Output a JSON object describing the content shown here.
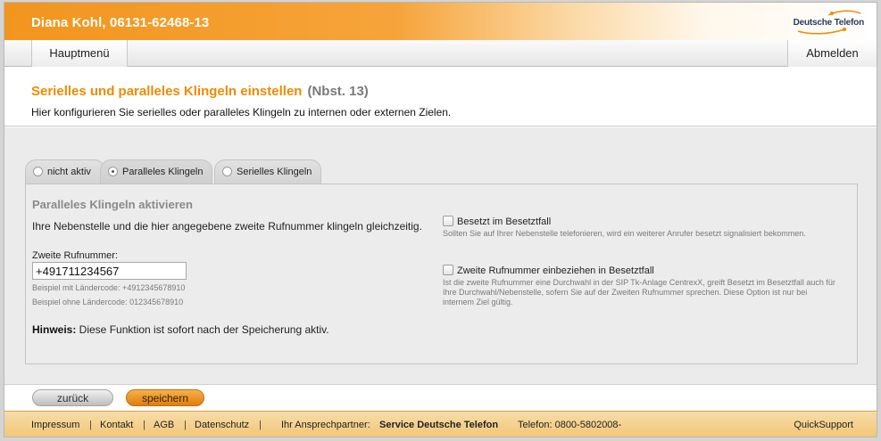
{
  "header": {
    "user": "Diana Kohl, 06131-62468-13",
    "logo_text": "Deutsche Telefon"
  },
  "nav": {
    "main_menu": "Hauptmenü",
    "logout": "Abmelden"
  },
  "page": {
    "title": "Serielles und paralleles Klingeln einstellen",
    "extension": "(Nbst. 13)",
    "description": "Hier konfigurieren Sie serielles oder paralleles Klingeln zu internen oder externen Zielen."
  },
  "tabs": [
    {
      "label": "nicht aktiv",
      "selected": false
    },
    {
      "label": "Paralleles Klingeln",
      "selected": true
    },
    {
      "label": "Serielles Klingeln",
      "selected": false
    }
  ],
  "panel": {
    "title": "Paralleles Klingeln aktivieren",
    "description": "Ihre Nebenstelle und die hier angegebene zweite Rufnummer klingeln gleichzeitig.",
    "field_label": "Zweite Rufnummer:",
    "phone_value": "+491711234567",
    "hint_with_country": "Beispiel mit Ländercode: +4912345678910",
    "hint_without_country": "Beispiel ohne Ländercode: 012345678910",
    "note_label": "Hinweis:",
    "note_text": " Diese Funktion ist sofort nach der Speicherung aktiv.",
    "options": [
      {
        "label": "Besetzt im Besetztfall",
        "checked": false,
        "description": "Sollten Sie auf Ihrer Nebenstelle telefonieren, wird ein weiterer Anrufer besetzt signalisiert bekommen."
      },
      {
        "label": "Zweite Rufnummer einbeziehen in Besetztfall",
        "checked": false,
        "description": "Ist die zweite Rufnummer eine Durchwahl in der SIP Tk-Anlage CentrexX, greift Besetzt im Besetztfall auch für Ihre Durchwahl/Nebenstelle, sofern Sie auf der Zweiten Rufnummer sprechen. Diese Option ist nur bei internem Ziel gültig."
      }
    ]
  },
  "actions": {
    "back": "zurück",
    "save": "speichern"
  },
  "footer": {
    "impressum": "Impressum",
    "kontakt": "Kontakt",
    "agb": "AGB",
    "datenschutz": "Datenschutz",
    "separator": "|",
    "contact_label": "Ihr Ansprechpartner:",
    "contact_name": "Service Deutsche Telefon",
    "phone": "Telefon: 0800-5802008-",
    "quicksupport": "QuickSupport"
  },
  "colors": {
    "brand_orange": "#f08a00",
    "header_orange": "#f2951d",
    "footer_yellow": "#f2c674"
  }
}
